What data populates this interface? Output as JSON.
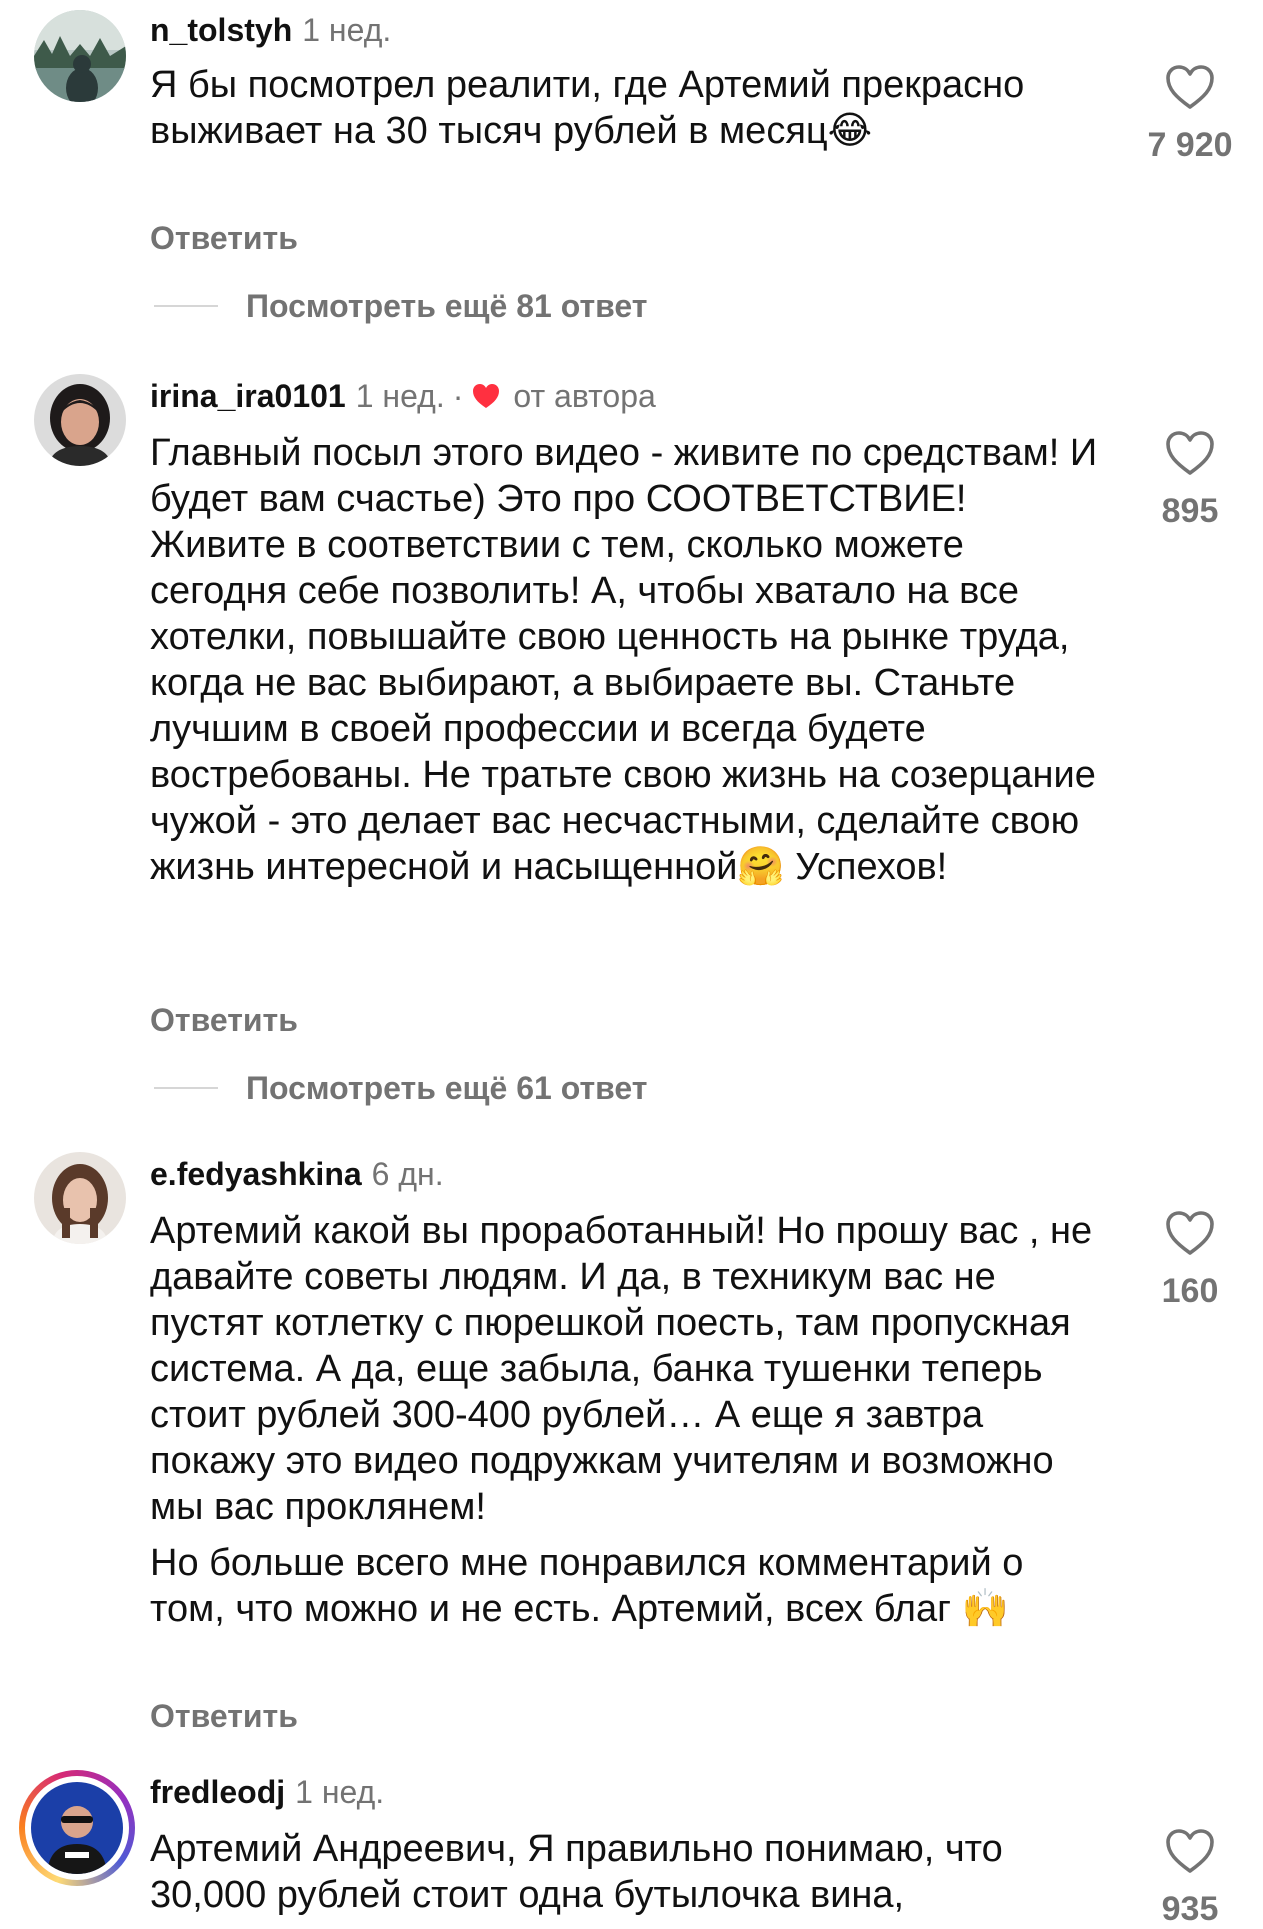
{
  "comments": [
    {
      "username": "n_tolstyh",
      "time": "1 нед.",
      "text": [
        "Я бы посмотрел реалити, где Артемий прекрасно выживает на 30 тысяч рублей в месяц😂"
      ],
      "reply_label": "Ответить",
      "more_replies": "Посмотреть ещё 81 ответ",
      "likes": "7 920",
      "avatar_icon": "landscape-avatar"
    },
    {
      "username": "irina_ira0101",
      "time": "1 нед.",
      "separator": "·",
      "author_badge": "от автора",
      "text": [
        "Главный посыл этого видео - живите по средствам! И будет вам счастье) Это про СООТВЕТСТВИЕ! Живите в соответствии с тем, сколько можете сегодня себе позволить! А, чтобы хватало на все хотелки, повышайте свою ценность на рынке труда, когда не вас выбирают, а выбираете вы. Станьте лучшим в своей профессии и всегда будете востребованы. Не тратьте свою жизнь на созерцание чужой - это делает вас несчастными, сделайте свою жизнь интересной и насыщенной🤗 Успехов!"
      ],
      "reply_label": "Ответить",
      "more_replies": "Посмотреть ещё 61 ответ",
      "likes": "895",
      "avatar_icon": "woman-avatar"
    },
    {
      "username": "e.fedyashkina",
      "time": "6 дн.",
      "text": [
        "Артемий какой вы проработанный! Но прошу вас , не давайте советы людям. И да, в техникум вас не пустят котлетку с пюрешкой поесть, там пропускная система. А да, еще забыла, банка тушенки теперь стоит рублей 300-400 рублей… А еще я завтра покажу это видео подружкам учителям и возможно мы вас проклянем!",
        "Но больше всего мне понравился комментарий о том, что можно и не есть. Артемий, всех благ 🙌"
      ],
      "reply_label": "Ответить",
      "likes": "160",
      "avatar_icon": "girl-avatar"
    },
    {
      "username": "fredleodj",
      "time": "1 нед.",
      "text": [
        "Артемий Андреевич, Я правильно понимаю, что 30,000 рублей стоит одна бутылочка вина,"
      ],
      "likes": "935",
      "avatar_icon": "dj-avatar"
    }
  ],
  "colors": {
    "secondary_text": "#737373",
    "author_heart": "#ff3040",
    "story_ring": [
      "#feda75",
      "#fa7e1e",
      "#d62976",
      "#962fbf",
      "#4f5bd5"
    ]
  }
}
